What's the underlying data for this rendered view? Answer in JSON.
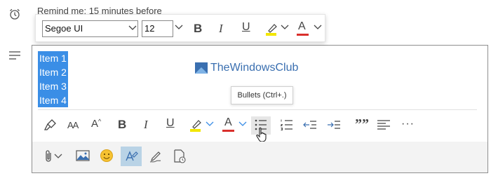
{
  "reminder": {
    "text": "Remind me: 15 minutes before",
    "icon": "alarm-clock-icon"
  },
  "mini_toolbar": {
    "font_family": "Segoe UI",
    "font_size": "12",
    "bold_label": "B",
    "italic_label": "I",
    "underline_label": "U",
    "font_color_label": "A"
  },
  "editor": {
    "lines": [
      "Item 1",
      "Item 2",
      "Item 3",
      "Item 4"
    ],
    "selection_color": "#3a8ee6"
  },
  "watermark": {
    "text": "TheWindowsClub"
  },
  "tooltip": {
    "text": "Bullets (Ctrl+.)"
  },
  "format_toolbar": {
    "bold_label": "B",
    "italic_label": "I",
    "underline_label": "U",
    "font_color_label": "A",
    "font_size_label": "AA",
    "grow_font_label": "A",
    "quote_label": "””",
    "more_label": "···"
  },
  "colors": {
    "highlight": "#f2e600",
    "font_color": "#d9302c",
    "accent": "#3a8ee6",
    "active_button": "#b9d3e6"
  }
}
